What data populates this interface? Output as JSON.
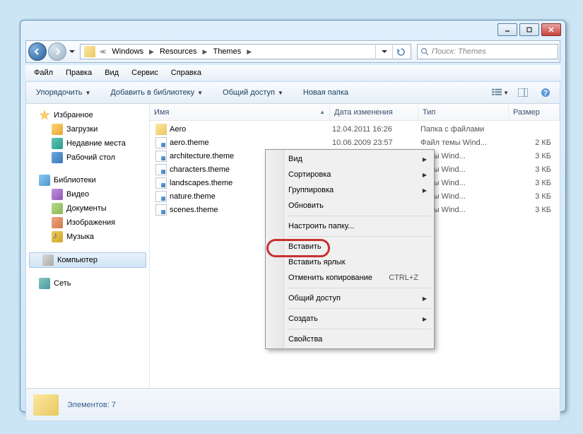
{
  "breadcrumb": [
    "Windows",
    "Resources",
    "Themes"
  ],
  "search_placeholder": "Поиск: Themes",
  "menubar": [
    "Файл",
    "Правка",
    "Вид",
    "Сервис",
    "Справка"
  ],
  "toolbar": {
    "organize": "Упорядочить",
    "addlib": "Добавить в библиотеку",
    "share": "Общий доступ",
    "newfolder": "Новая папка"
  },
  "sidebar": {
    "favorites": "Избранное",
    "downloads": "Загрузки",
    "recent": "Недавние места",
    "desktop": "Рабочий стол",
    "libraries": "Библиотеки",
    "video": "Видео",
    "documents": "Документы",
    "images": "Изображения",
    "music": "Музыка",
    "computer": "Компьютер",
    "network": "Сеть"
  },
  "columns": {
    "name": "Имя",
    "date": "Дата изменения",
    "type": "Тип",
    "size": "Размер"
  },
  "files": [
    {
      "name": "Aero",
      "date": "12.04.2011 16:26",
      "type": "Папка с файлами",
      "size": "",
      "icon": "folder"
    },
    {
      "name": "aero.theme",
      "date": "10.06.2009 23:57",
      "type": "Файл темы Wind...",
      "size": "2 КБ",
      "icon": "theme"
    },
    {
      "name": "architecture.theme",
      "date": "",
      "type": "темы Wind...",
      "size": "3 КБ",
      "icon": "theme"
    },
    {
      "name": "characters.theme",
      "date": "",
      "type": "темы Wind...",
      "size": "3 КБ",
      "icon": "theme"
    },
    {
      "name": "landscapes.theme",
      "date": "",
      "type": "темы Wind...",
      "size": "3 КБ",
      "icon": "theme"
    },
    {
      "name": "nature.theme",
      "date": "",
      "type": "темы Wind...",
      "size": "3 КБ",
      "icon": "theme"
    },
    {
      "name": "scenes.theme",
      "date": "",
      "type": "темы Wind...",
      "size": "3 КБ",
      "icon": "theme"
    }
  ],
  "status": "Элементов: 7",
  "context": {
    "view": "Вид",
    "sort": "Сортировка",
    "group": "Группировка",
    "refresh": "Обновить",
    "customize": "Настроить папку...",
    "paste": "Вставить",
    "paste_shortcut": "Вставить ярлык",
    "undo": "Отменить копирование",
    "undo_key": "CTRL+Z",
    "sharing": "Общий доступ",
    "new": "Создать",
    "properties": "Свойства"
  }
}
